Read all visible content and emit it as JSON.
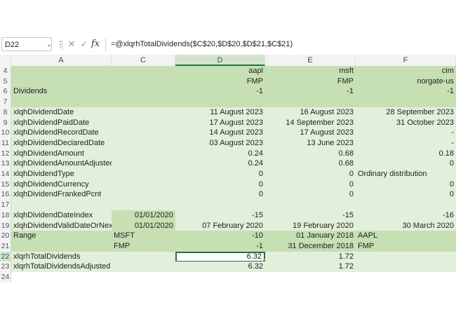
{
  "formula_bar": {
    "name_box": "D22",
    "formula": "=@xlqrhTotalDividends($C$20,$D$20,$D$21,$C$21)"
  },
  "columns": [
    {
      "id": "A",
      "label": "A"
    },
    {
      "id": "C",
      "label": "C"
    },
    {
      "id": "D",
      "label": "D"
    },
    {
      "id": "E",
      "label": "E"
    },
    {
      "id": "F",
      "label": "F"
    }
  ],
  "active_column": "D",
  "active_row": "22",
  "colors": {
    "header_band": "#c6e0b4",
    "light_band": "#e2efda",
    "accent": "#217346"
  },
  "rows": [
    {
      "n": "4",
      "A": "",
      "C": "",
      "D": "aapl",
      "E": "msft",
      "F": "cim"
    },
    {
      "n": "5",
      "A": "",
      "C": "",
      "D": "FMP",
      "E": "FMP",
      "F": "norgate-us"
    },
    {
      "n": "6",
      "A": "Dividends",
      "C": "",
      "D": "-1",
      "E": "-1",
      "F": "-1"
    },
    {
      "n": "7",
      "A": "",
      "C": "",
      "D": "",
      "E": "",
      "F": ""
    },
    {
      "n": "8",
      "A": "xlqhDividendDate",
      "C": "",
      "D": "11 August 2023",
      "E": "16 August 2023",
      "F": "28 September 2023"
    },
    {
      "n": "9",
      "A": "xlqhDividendPaidDate",
      "C": "",
      "D": "17 August 2023",
      "E": "14 September 2023",
      "F": "31 October 2023"
    },
    {
      "n": "10",
      "A": "xlqhDividendRecordDate",
      "C": "",
      "D": "14 August 2023",
      "E": "17 August 2023",
      "F": "-"
    },
    {
      "n": "11",
      "A": "xlqhDividendDeclaredDate",
      "C": "",
      "D": "03 August 2023",
      "E": "13 June 2023",
      "F": "-"
    },
    {
      "n": "12",
      "A": "xlqhDividendAmount",
      "C": "",
      "D": "0.24",
      "E": "0.68",
      "F": "0.18"
    },
    {
      "n": "13",
      "A": "xlqhDividendAmountAdjusted",
      "C": "",
      "D": "0.24",
      "E": "0.68",
      "F": "0"
    },
    {
      "n": "14",
      "A": "xlqhDividendType",
      "C": "",
      "D": "0",
      "E": "0",
      "F": "Ordinary distribution"
    },
    {
      "n": "15",
      "A": "xlqhDividendCurrency",
      "C": "",
      "D": "0",
      "E": "0",
      "F": "0"
    },
    {
      "n": "16",
      "A": "xlqhDividendFrankedPcnt",
      "C": "",
      "D": "0",
      "E": "0",
      "F": "0"
    },
    {
      "n": "17",
      "A": "",
      "C": "",
      "D": "",
      "E": "",
      "F": ""
    },
    {
      "n": "18",
      "A": "xlqhDividendDateIndex",
      "C": "01/01/2020",
      "D": "-15",
      "E": "-15",
      "F": "-16"
    },
    {
      "n": "19",
      "A": "xlqhDividendValidDateOrNext",
      "C": "01/01/2020",
      "D": "07 February 2020",
      "E": "19 February 2020",
      "F": "30 March 2020"
    },
    {
      "n": "20",
      "A": "Range",
      "C": "MSFT",
      "D": "-10",
      "E": "01 January 2018",
      "F": "AAPL"
    },
    {
      "n": "21",
      "A": "",
      "C": "FMP",
      "D": "-1",
      "E": "31 December 2018",
      "F": "FMP"
    },
    {
      "n": "22",
      "A": "xlqrhTotalDividends",
      "C": "",
      "D": "6.32",
      "E": "1.72",
      "F": ""
    },
    {
      "n": "23",
      "A": "xlqrhTotalDividendsAdjusted",
      "C": "",
      "D": "6.32",
      "E": "1.72",
      "F": ""
    },
    {
      "n": "24",
      "A": "",
      "C": "",
      "D": "",
      "E": "",
      "F": ""
    }
  ]
}
